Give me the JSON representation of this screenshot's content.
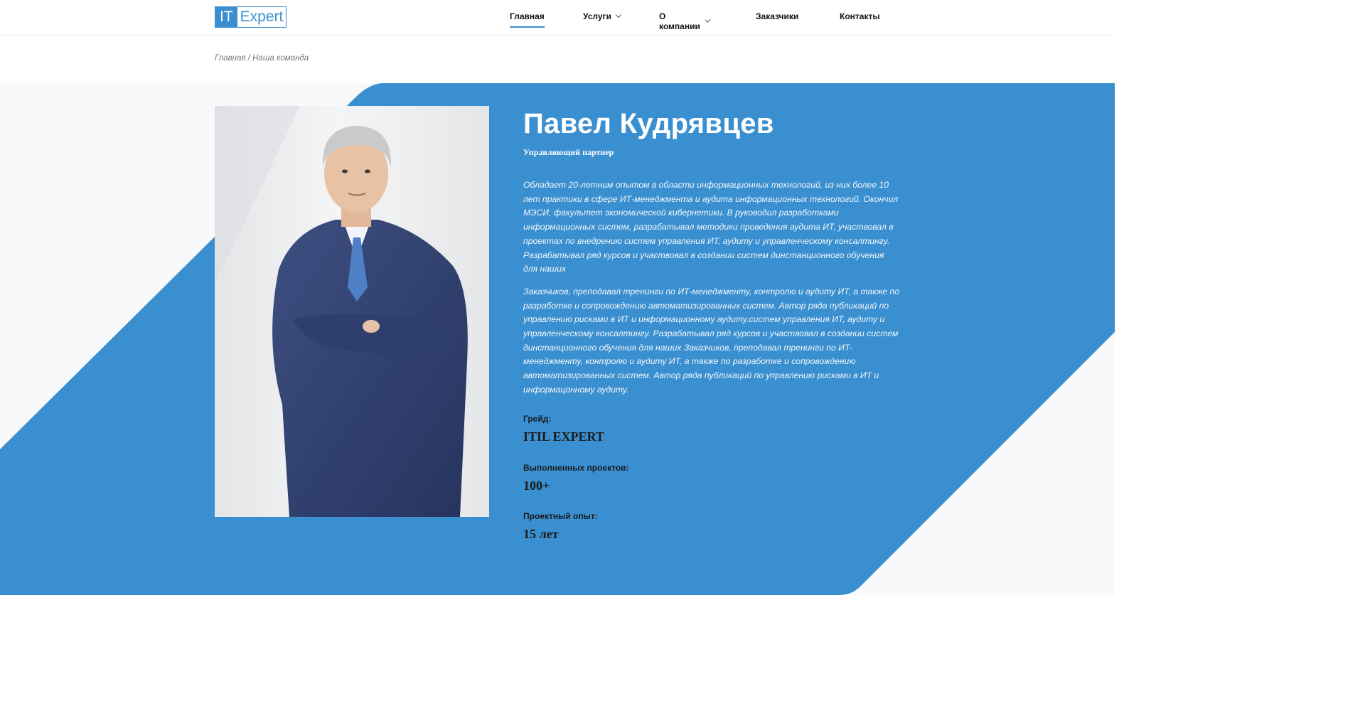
{
  "logo": {
    "part1": "IT",
    "part2": "Expert"
  },
  "nav": [
    {
      "label": "Главная",
      "active": true,
      "dropdown": false
    },
    {
      "label": "Услуги",
      "active": false,
      "dropdown": true
    },
    {
      "label": "О компании",
      "active": false,
      "dropdown": true
    },
    {
      "label": "Заказчики",
      "active": false,
      "dropdown": false
    },
    {
      "label": "Контакты",
      "active": false,
      "dropdown": false
    }
  ],
  "breadcrumb": {
    "home": "Главная",
    "separator": "/",
    "current": "Наша команда"
  },
  "profile": {
    "name": "Павел Кудрявцев",
    "role": "Управляющий партнер",
    "bio_p1": "Обладает 20-летним опытом в области информационных технологий, из них более 10 лет практики в сфере ИТ-менеджмента и аудита информационных технологий. Окончил МЭСИ, факультет экономической кибернетики. В руководил разработками информационных систем, разрабатывал методики проведения аудита ИТ, участвовал в проектах по внедрению систем управления ИТ, аудиту и управленческому консалтингу. Разрабатывал ряд курсов и участвовал в создании систем динстанционного обучения для наших",
    "bio_p2": "Заказчиков, преподавал тренинги по ИТ-менеджменту, контролю и аудиту ИТ, а также по разработке и сопровождению автоматизированных систем. Автор ряда публикаций по управлению рисками в ИТ и информационному аудиту.систем управления ИТ, аудиту и управленческому консалтингу. Разрабатывал ряд курсов и участвовал в создании систем динстанционного обучения для наших Заказчиков, преподавал тренинги по ИТ-менеджменту, контролю и аудиту ИТ, а также по разработке и сопровождению автоматизированных систем. Автор ряда публикаций по управлению рисками в ИТ и информацонному аудиту.",
    "stats": [
      {
        "label": "Грейд:",
        "value": "ITIL EXPERT"
      },
      {
        "label": "Выполненных проектов:",
        "value": "100+"
      },
      {
        "label": "Проектный опыт:",
        "value": "15 лет"
      }
    ]
  },
  "colors": {
    "accent": "#3a8fd0",
    "band_bg": "#f7f9fb"
  }
}
